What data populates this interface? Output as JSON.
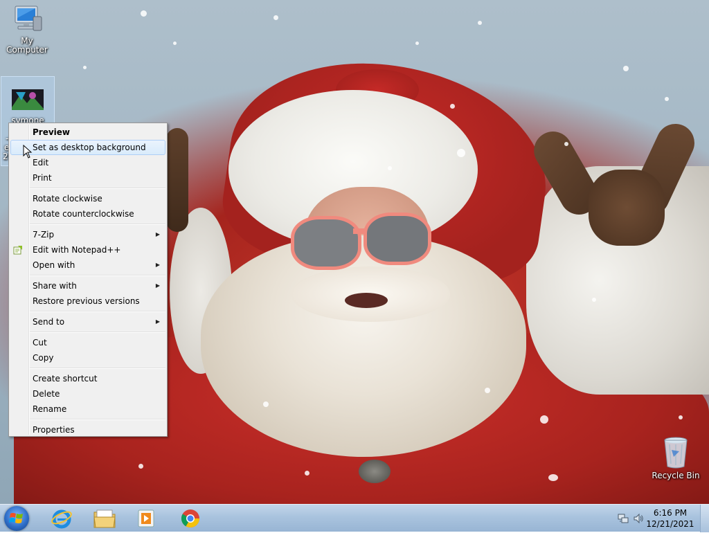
{
  "desktop": {
    "icons": [
      {
        "id": "my-computer",
        "label": "My Computer"
      },
      {
        "id": "symone-file",
        "label_lines": [
          "symone wide",
          "-c",
          "ef",
          "2c"
        ]
      },
      {
        "id": "recycle-bin",
        "label": "Recycle Bin"
      }
    ]
  },
  "context_menu": {
    "items": [
      {
        "label": "Preview",
        "bold": true
      },
      {
        "label": "Set as desktop background",
        "highlighted": true
      },
      {
        "label": "Edit"
      },
      {
        "label": "Print"
      },
      {
        "label": "Rotate clockwise"
      },
      {
        "label": "Rotate counterclockwise"
      },
      {
        "label": "7-Zip",
        "submenu": true
      },
      {
        "label": "Edit with Notepad++",
        "icon": "notepad-plus-icon"
      },
      {
        "label": "Open with",
        "submenu": true
      },
      {
        "label": "Share with",
        "submenu": true
      },
      {
        "label": "Restore previous versions"
      },
      {
        "label": "Send to",
        "submenu": true
      },
      {
        "label": "Cut"
      },
      {
        "label": "Copy"
      },
      {
        "label": "Create shortcut"
      },
      {
        "label": "Delete"
      },
      {
        "label": "Rename"
      },
      {
        "label": "Properties"
      }
    ],
    "submenu_arrow": "▶"
  },
  "taskbar": {
    "pinned": [
      {
        "id": "internet-explorer",
        "icon": "ie-icon"
      },
      {
        "id": "file-explorer",
        "icon": "folder-icon"
      },
      {
        "id": "media-player",
        "icon": "media-player-icon"
      },
      {
        "id": "chrome",
        "icon": "chrome-icon"
      }
    ],
    "clock": {
      "time": "6:16 PM",
      "date": "12/21/2021"
    }
  },
  "colors": {
    "taskbar": "#a9c3de",
    "menu_bg": "#f0f0f0",
    "menu_highlight": "#d9ebfb"
  }
}
